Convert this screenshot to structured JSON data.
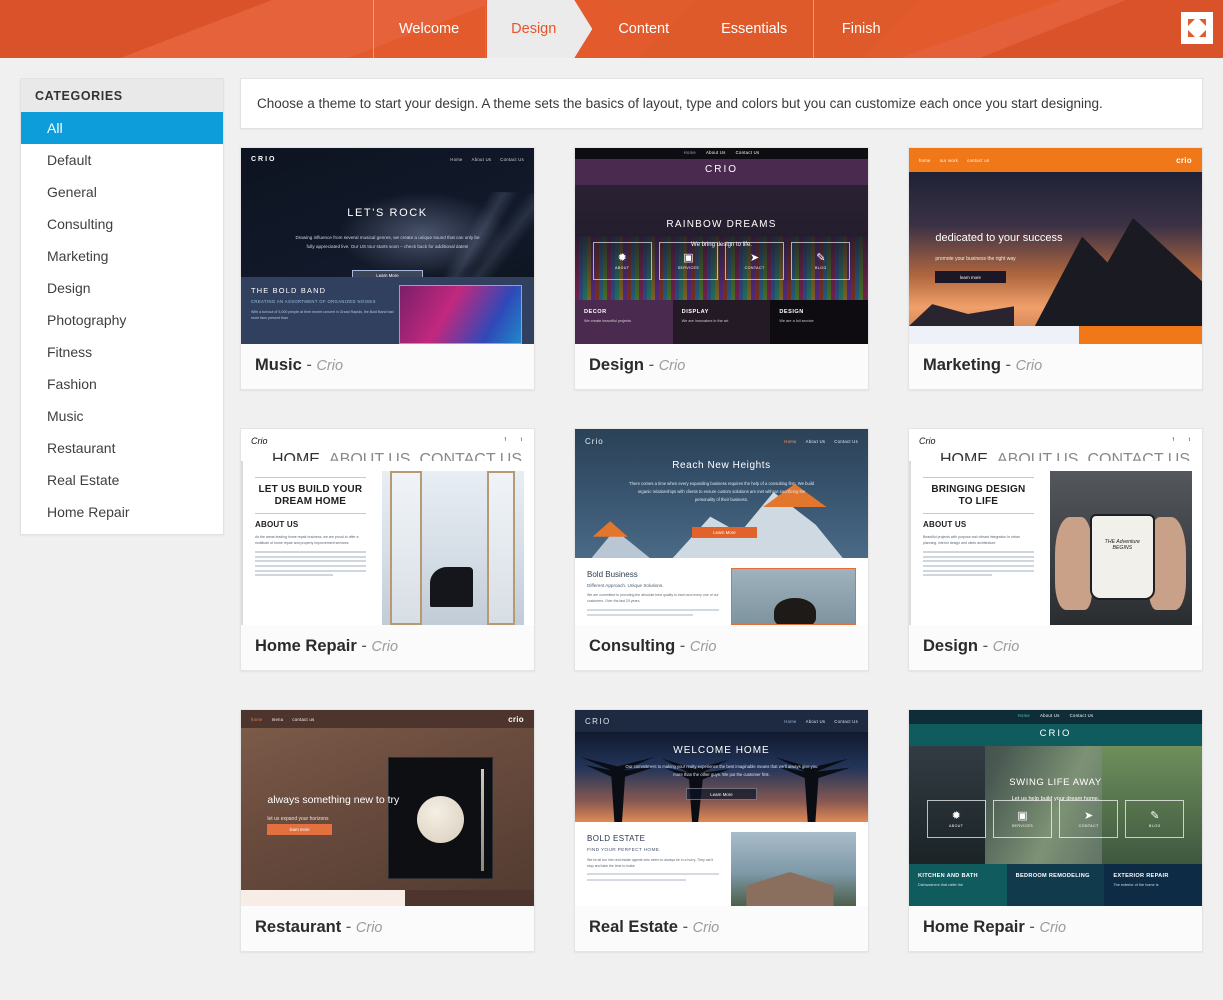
{
  "header": {
    "steps": [
      {
        "label": "Welcome",
        "active": false
      },
      {
        "label": "Design",
        "active": true
      },
      {
        "label": "Content",
        "active": false
      },
      {
        "label": "Essentials",
        "active": false
      },
      {
        "label": "Finish",
        "active": false
      }
    ],
    "restore_icon": "restore-collapse-icon",
    "accent_color": "#e35b2c",
    "active_step_bg": "#ebebeb",
    "active_step_text": "#e8542a"
  },
  "sidebar": {
    "title": "CATEGORIES",
    "selected": "All",
    "selected_color": "#0d9ddb",
    "items": [
      {
        "label": "All"
      },
      {
        "label": "Default"
      },
      {
        "label": "General"
      },
      {
        "label": "Consulting"
      },
      {
        "label": "Marketing"
      },
      {
        "label": "Design"
      },
      {
        "label": "Photography"
      },
      {
        "label": "Fitness"
      },
      {
        "label": "Fashion"
      },
      {
        "label": "Music"
      },
      {
        "label": "Restaurant"
      },
      {
        "label": "Real Estate"
      },
      {
        "label": "Home Repair"
      }
    ]
  },
  "instruction": "Choose a theme to start your design. A theme sets the basics of layout, type and colors but you can customize each once you start designing.",
  "themes": [
    {
      "name": "Music",
      "separator": "-",
      "template": "Crio",
      "preview": {
        "brand": "CRIO",
        "nav": [
          "Home",
          "About Us",
          "Contact Us"
        ],
        "headline": "LET'S ROCK",
        "body": "Drawing influence from several musical genres, we create a unique sound that can only be fully appreciated live. Our US tour starts soon – check back for additional dates!",
        "button": "Learn More",
        "section_title": "THE BOLD BAND",
        "section_sub": "CREATING AN ASSORTMENT OF ORGANIZED NOISES",
        "section_body": "With a turnout of 5,000 people at their recent concert in Grand Rapids, the Bold Band had more fans present than"
      }
    },
    {
      "name": "Design",
      "separator": "-",
      "template": "Crio",
      "preview": {
        "brand": "CRIO",
        "nav": [
          "Home",
          "About Us",
          "Contact Us"
        ],
        "headline": "RAINBOW DREAMS",
        "subhead": "We bring design to life.",
        "tiles": [
          {
            "icon": "gear-icon",
            "glyph": "✹",
            "label": "ABOUT"
          },
          {
            "icon": "briefcase-icon",
            "glyph": "▣",
            "label": "SERVICES"
          },
          {
            "icon": "paper-plane-icon",
            "glyph": "➤",
            "label": "CONTACT"
          },
          {
            "icon": "pencil-square-icon",
            "glyph": "✎",
            "label": "BLOG"
          }
        ],
        "columns": [
          {
            "title": "DECOR",
            "text": "We create beautiful projects"
          },
          {
            "title": "DISPLAY",
            "text": "We are innovators in the art"
          },
          {
            "title": "DESIGN",
            "text": "We are a full service"
          }
        ]
      }
    },
    {
      "name": "Marketing",
      "separator": "-",
      "template": "Crio",
      "preview": {
        "brand": "crio",
        "nav": [
          "home",
          "our work",
          "contact us"
        ],
        "headline": "dedicated to your success",
        "subhead": "promote your business the right way",
        "button": "learn more"
      }
    },
    {
      "name": "Home Repair",
      "separator": "-",
      "template": "Crio",
      "preview": {
        "brand": "Crio",
        "nav": [
          "HOME",
          "ABOUT US",
          "CONTACT US"
        ],
        "social": [
          "f",
          "t"
        ],
        "headline": "LET US BUILD YOUR DREAM HOME",
        "section_title": "ABOUT US",
        "body": "As the areas leading home repair business, we are proud to offer a multitude of home repair and property improvement services."
      }
    },
    {
      "name": "Consulting",
      "separator": "-",
      "template": "Crio",
      "preview": {
        "brand": "Crio",
        "nav": [
          "Home",
          "About Us",
          "Contact Us"
        ],
        "headline": "Reach New Heights",
        "body": "There comes a time when every expanding business requires the help of a consulting firm. We build organic relationships with clients to ensure custom solutions are met without sacrificing the personality of their business.",
        "button": "Learn More",
        "section_title": "Bold Business",
        "section_sub": "Different Approach. Unique Solutions.",
        "section_body": "We are committed to providing the absolute best quality to each and every one of our customers. Over the last 20 years,"
      }
    },
    {
      "name": "Design",
      "separator": "-",
      "template": "Crio",
      "preview": {
        "brand": "Crio",
        "nav": [
          "HOME",
          "ABOUT US",
          "CONTACT US"
        ],
        "social": [
          "f",
          "t"
        ],
        "headline": "BRINGING DESIGN TO LIFE",
        "section_title": "ABOUT US",
        "body": "Beautiful projects with purpose and vibrant integration in urban planning, interior design and sleek architecture.",
        "image_text": "THE Adventure BEGINS"
      }
    },
    {
      "name": "Restaurant",
      "separator": "-",
      "template": "Crio",
      "preview": {
        "brand": "crio",
        "nav": [
          "home",
          "menu",
          "contact us"
        ],
        "headline": "always something new to try",
        "subhead": "let us expand your horizons",
        "button": "learn more"
      }
    },
    {
      "name": "Real Estate",
      "separator": "-",
      "template": "Crio",
      "preview": {
        "brand": "CRIO",
        "nav": [
          "Home",
          "About Us",
          "Contact Us"
        ],
        "headline": "WELCOME HOME",
        "body": "Our commitment to making your realty experience the best imaginable means that we'll always give you more than the other guys. We put the customer first.",
        "button": "Learn More",
        "section_title": "BOLD ESTATE",
        "section_sub": "FIND YOUR PERFECT HOME.",
        "section_body": "We've all run into real estate agents who seem to always be in a hurry. They can't stop and take the time to make"
      }
    },
    {
      "name": "Home Repair",
      "separator": "-",
      "template": "Crio",
      "preview": {
        "brand": "CRIO",
        "nav": [
          "Home",
          "About Us",
          "Contact Us"
        ],
        "headline": "SWING LIFE AWAY",
        "subhead": "Let us help build your dream home.",
        "tiles": [
          {
            "icon": "gear-icon",
            "glyph": "✹",
            "label": "ABOUT"
          },
          {
            "icon": "briefcase-icon",
            "glyph": "▣",
            "label": "SERVICES"
          },
          {
            "icon": "paper-plane-icon",
            "glyph": "➤",
            "label": "CONTACT"
          },
          {
            "icon": "pencil-square-icon",
            "glyph": "✎",
            "label": "BLOG"
          }
        ],
        "columns": [
          {
            "title": "KITCHEN AND BATH",
            "text": "Dishwashers that rattle the"
          },
          {
            "title": "BEDROOM REMODELING",
            "text": ""
          },
          {
            "title": "EXTERIOR REPAIR",
            "text": "The exterior of the home is"
          }
        ]
      }
    }
  ]
}
